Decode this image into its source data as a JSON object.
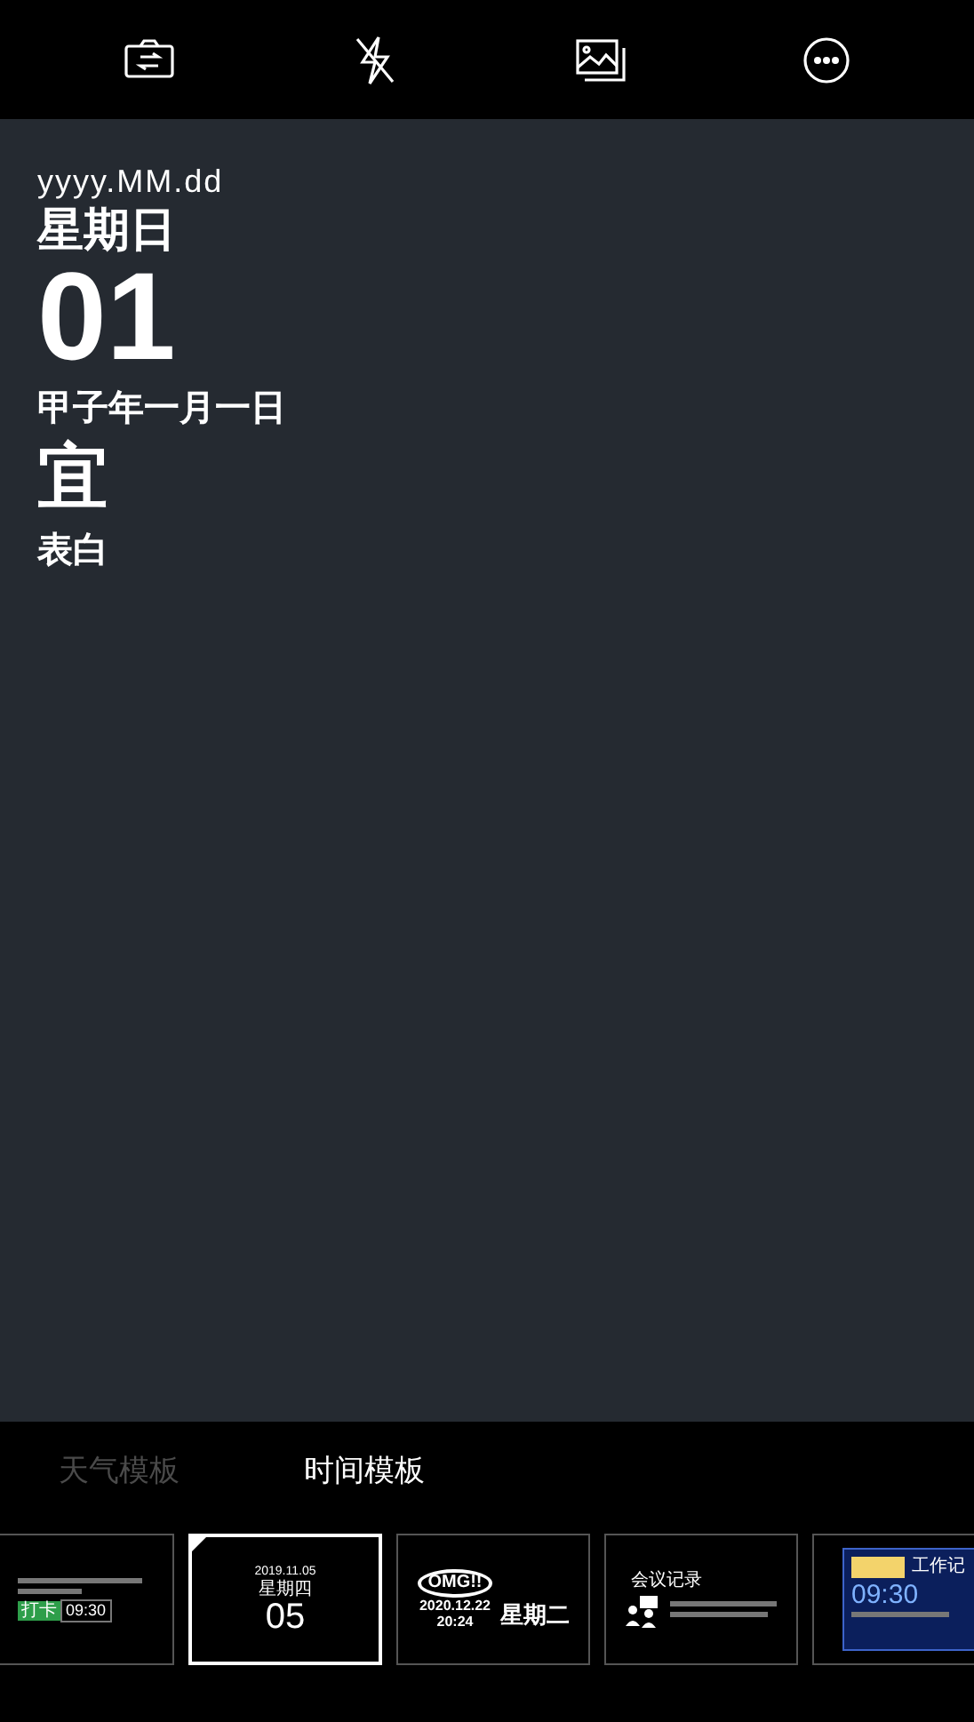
{
  "toolbar": [
    {
      "kind": "switch-camera"
    },
    {
      "kind": "flash-off"
    },
    {
      "kind": "gallery"
    },
    {
      "kind": "more"
    }
  ],
  "preview": {
    "date_format": "yyyy.MM.dd",
    "weekday": "星期日",
    "day": "01",
    "lunar_date": "甲子年一月一日",
    "suitable_label": "宜",
    "suitable_item": "表白"
  },
  "tabs": [
    {
      "label": "天气模板",
      "selected": false
    },
    {
      "label": "时间模板",
      "selected": true
    }
  ],
  "templates": [
    {
      "kind": "checkin",
      "selected": false,
      "badge": "打卡",
      "time": "09:30"
    },
    {
      "kind": "date",
      "selected": true,
      "date": "2019.11.05",
      "weekday": "星期四",
      "day": "05"
    },
    {
      "kind": "omg",
      "selected": false,
      "bubble": "OMG!!",
      "date": "2020.12.22",
      "time": "20:24",
      "weekday": "星期二"
    },
    {
      "kind": "meeting",
      "selected": false,
      "title": "会议记录"
    },
    {
      "kind": "worklog",
      "selected": false,
      "tag": "工作记",
      "time": "09:30"
    }
  ]
}
